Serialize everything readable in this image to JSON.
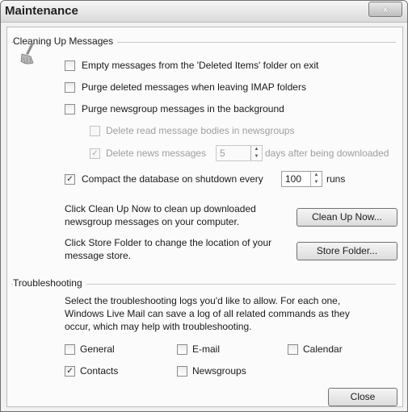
{
  "window": {
    "title": "Maintenance",
    "close_glyph": "x"
  },
  "cleanup": {
    "group_label": "Cleaning Up Messages",
    "empty_deleted": {
      "label": "Empty messages from the 'Deleted Items' folder on exit",
      "checked": false
    },
    "purge_imap": {
      "label": "Purge deleted messages when leaving IMAP folders",
      "checked": false
    },
    "purge_news": {
      "label": "Purge newsgroup messages in the background",
      "checked": false
    },
    "delete_bodies": {
      "label": "Delete read message bodies in newsgroups",
      "checked": false,
      "enabled": false
    },
    "delete_news": {
      "label": "Delete news messages",
      "checked": true,
      "enabled": false,
      "days": "5",
      "suffix": "days after being downloaded"
    },
    "compact": {
      "label": "Compact the database on shutdown every",
      "checked": true,
      "runs": "100",
      "suffix": "runs"
    },
    "cleanup_text_1": "Click Clean Up Now to clean up downloaded",
    "cleanup_text_2": "newsgroup messages on your computer.",
    "cleanup_button": "Clean Up Now...",
    "store_text_1": "Click Store Folder to change the location of your",
    "store_text_2": "message store.",
    "store_button": "Store Folder..."
  },
  "troubleshooting": {
    "group_label": "Troubleshooting",
    "desc_1": "Select the troubleshooting logs you'd like to allow. For each one,",
    "desc_2": "Windows Live Mail can save a log of all related commands as they",
    "desc_3": "occur, which may help with troubleshooting.",
    "logs": {
      "general": {
        "label": "General",
        "checked": false
      },
      "email": {
        "label": "E-mail",
        "checked": false
      },
      "calendar": {
        "label": "Calendar",
        "checked": false
      },
      "contacts": {
        "label": "Contacts",
        "checked": true
      },
      "newsgroups": {
        "label": "Newsgroups",
        "checked": false
      }
    }
  },
  "footer": {
    "close_button": "Close"
  },
  "icons": {
    "broom": "broom-icon",
    "check": "✓",
    "spin_up": "▲",
    "spin_down": "▼"
  }
}
